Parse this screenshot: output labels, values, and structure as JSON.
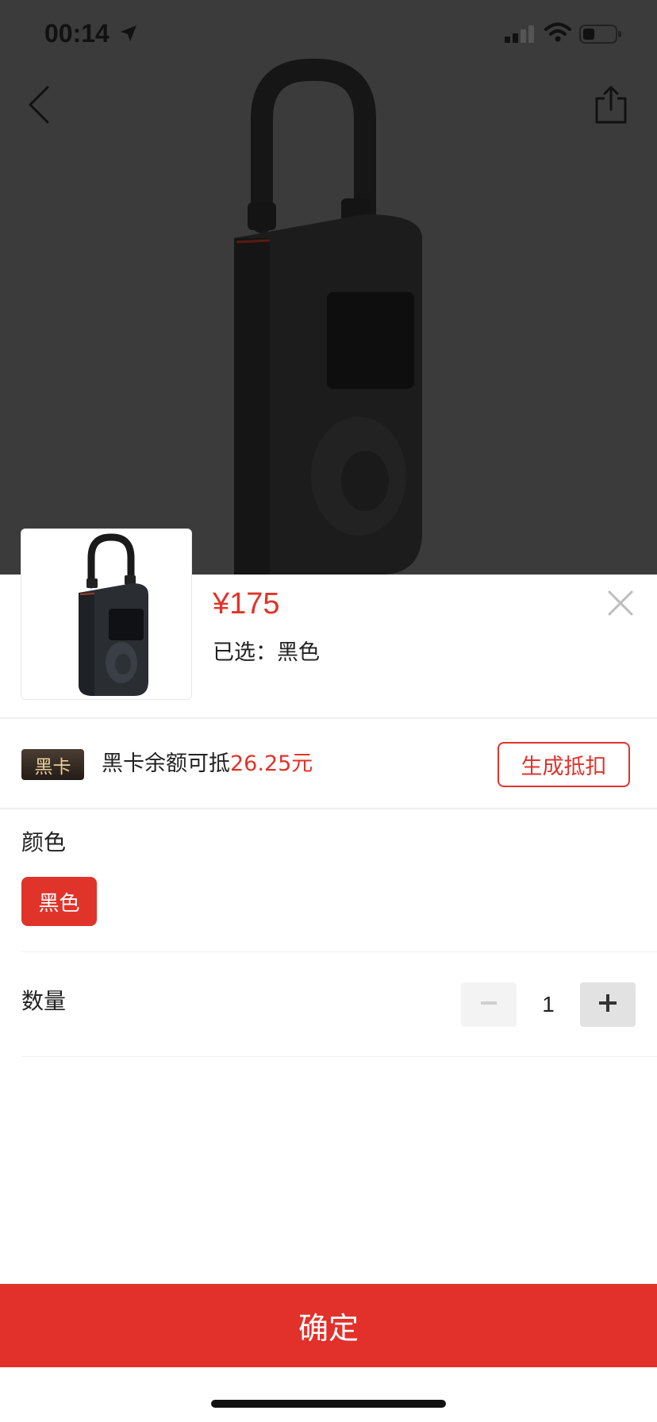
{
  "status_bar": {
    "time": "00:14",
    "icons": [
      "location-arrow-icon",
      "cellular-signal-icon",
      "wifi-icon",
      "battery-icon"
    ]
  },
  "nav": {
    "back_icon": "chevron-left-icon",
    "share_icon": "share-icon"
  },
  "product": {
    "price": "¥175",
    "selected_text": "已选：黑色"
  },
  "black_card": {
    "badge": "黑卡",
    "text_prefix": "黑卡余额可抵",
    "amount": "26.25元",
    "generate_label": "生成抵扣"
  },
  "color_section": {
    "label": "颜色",
    "options": [
      "黑色"
    ],
    "selected": "黑色"
  },
  "quantity_section": {
    "label": "数量",
    "value": "1",
    "minus_icon": "minus-icon",
    "plus_icon": "plus-icon"
  },
  "confirm_label": "确定",
  "colors": {
    "accent": "#e0342b",
    "overlay": "#3b3b3b",
    "badge_text": "#e9cf9c"
  }
}
